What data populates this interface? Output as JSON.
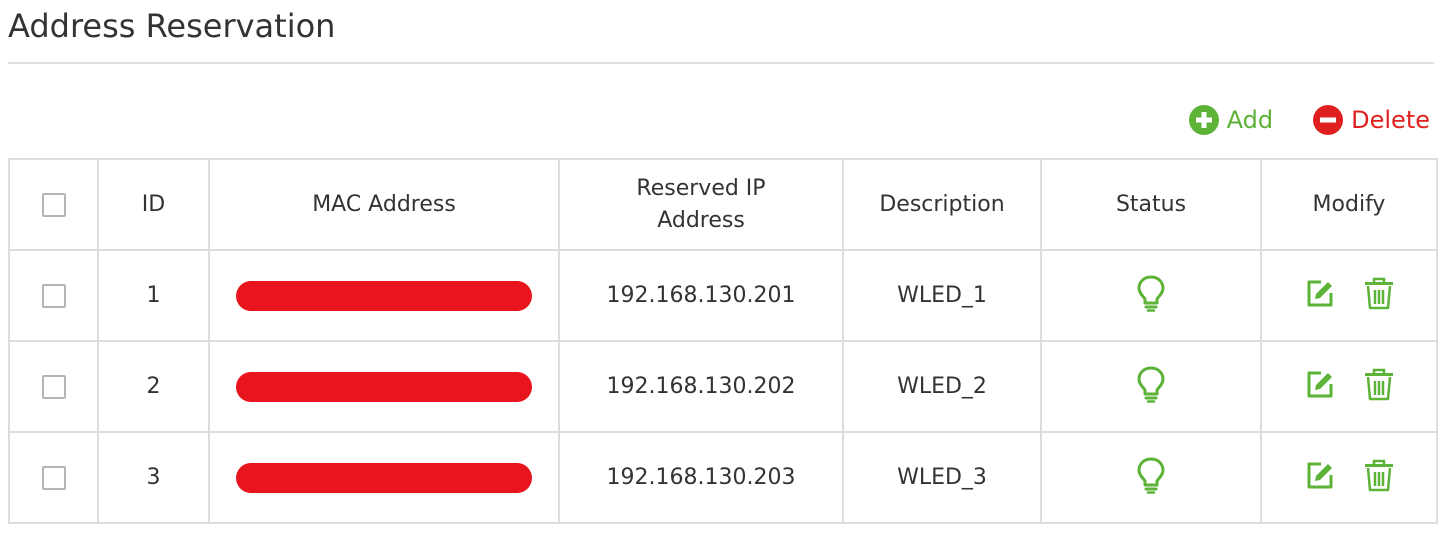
{
  "page": {
    "title": "Address Reservation"
  },
  "toolbar": {
    "add_label": "Add",
    "delete_label": "Delete",
    "add_icon": "plus-circle-icon",
    "delete_icon": "minus-circle-icon"
  },
  "table": {
    "headers": {
      "select": "",
      "id": "ID",
      "mac": "MAC Address",
      "reserved_ip": "Reserved IP Address",
      "description": "Description",
      "status": "Status",
      "modify": "Modify"
    },
    "rows": [
      {
        "id": "1",
        "mac": "",
        "ip": "192.168.130.201",
        "description": "WLED_1",
        "status_icon": "lightbulb-icon"
      },
      {
        "id": "2",
        "mac": "",
        "ip": "192.168.130.202",
        "description": "WLED_2",
        "status_icon": "lightbulb-icon"
      },
      {
        "id": "3",
        "mac": "",
        "ip": "192.168.130.203",
        "description": "WLED_3",
        "status_icon": "lightbulb-icon"
      }
    ]
  },
  "colors": {
    "accent_green": "#5cb338",
    "delete_red": "#e0201e",
    "redaction_red": "#e8151f",
    "border": "#dcdcdc"
  }
}
